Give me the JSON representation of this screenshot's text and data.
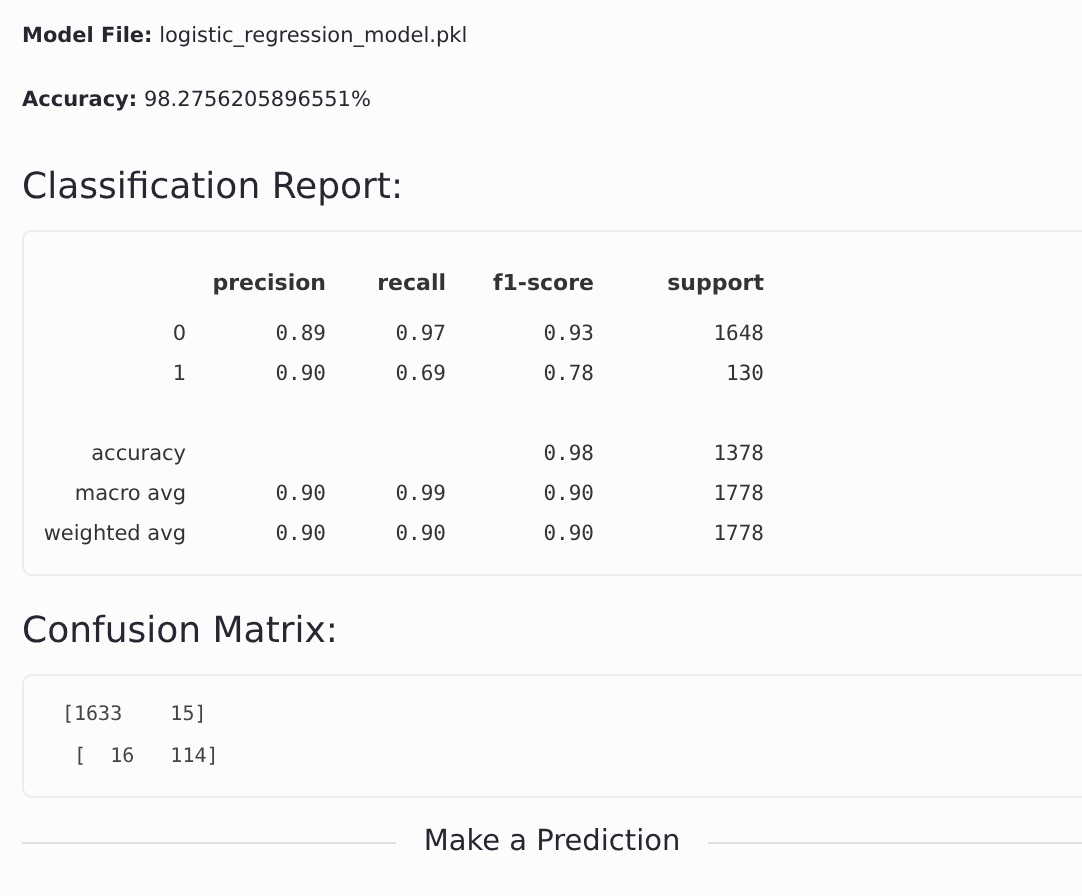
{
  "model_file": {
    "label": "Model File:",
    "value": "logistic_regression_model.pkl"
  },
  "accuracy": {
    "label": "Accuracy:",
    "value": "98.2756205896551%"
  },
  "classification_report": {
    "title": "Classification Report:",
    "columns": [
      "",
      "precision",
      "recall",
      "f1-score",
      "support"
    ],
    "rows": [
      [
        "0",
        "0.89",
        "0.97",
        "0.93",
        "1648"
      ],
      [
        "1",
        "0.90",
        "0.69",
        "0.78",
        "130"
      ],
      [],
      [
        "accuracy",
        "",
        "",
        "0.98",
        "1378"
      ],
      [
        "macro avg",
        "0.90",
        "0.99",
        "0.90",
        "1778"
      ],
      [
        "weighted avg",
        "0.90",
        "0.90",
        "0.90",
        "1778"
      ]
    ]
  },
  "confusion_matrix": {
    "title": "Confusion Matrix:",
    "lines": [
      "[1633    15]",
      " [  16   114]"
    ]
  },
  "divider": {
    "label": "Make a Prediction"
  }
}
